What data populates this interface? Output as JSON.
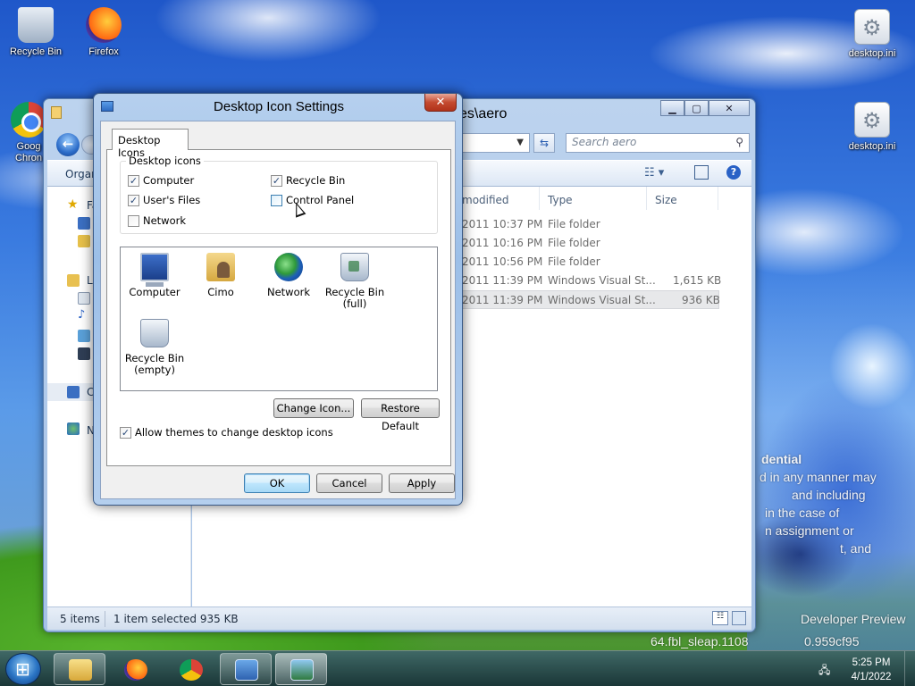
{
  "desktop": {
    "icons": [
      {
        "label": "Recycle Bin",
        "icon": "recycle-bin-icon"
      },
      {
        "label": "Firefox",
        "icon": "firefox-icon"
      },
      {
        "label_line1": "Goog",
        "label_line2": "Chron",
        "icon": "chrome-icon"
      },
      {
        "label": "desktop.ini",
        "icon": "settings-file-icon"
      },
      {
        "label": "desktop.ini",
        "icon": "settings-file-icon"
      }
    ],
    "wallpaper_text": [
      "dential",
      "d in any manner may",
      "and including",
      "in the case of",
      "n assignment or",
      "t, and",
      "Developer Preview",
      "64.fbl_sleap.1108",
      "0.959cf95"
    ]
  },
  "explorer": {
    "title": "es\\aero",
    "search_placeholder": "Search aero",
    "organize_label": "Organ",
    "nav_labels": {
      "favorites": "Fa",
      "libraries": "Li",
      "computer": "C",
      "network": "N"
    },
    "columns": {
      "date": "modified",
      "type": "Type",
      "size": "Size"
    },
    "rows": [
      {
        "date": "2011 10:37 PM",
        "type": "File folder",
        "size": ""
      },
      {
        "date": "2011 10:16 PM",
        "type": "File folder",
        "size": ""
      },
      {
        "date": "2011 10:56 PM",
        "type": "File folder",
        "size": ""
      },
      {
        "date": "2011 11:39 PM",
        "type": "Windows Visual St...",
        "size": "1,615 KB"
      },
      {
        "date": "2011 11:39 PM",
        "type": "Windows Visual St...",
        "size": "936 KB"
      }
    ],
    "status": {
      "count": "5 items",
      "selection": "1 item selected  935 KB"
    }
  },
  "dialog": {
    "title": "Desktop Icon Settings",
    "tab_label": "Desktop Icons",
    "group_label": "Desktop icons",
    "checkboxes": {
      "computer": {
        "label": "Computer",
        "checked": true
      },
      "recycle_bin": {
        "label": "Recycle Bin",
        "checked": true
      },
      "users_files": {
        "label": "User's Files",
        "checked": true
      },
      "control_panel": {
        "label": "Control Panel",
        "checked": false
      },
      "network": {
        "label": "Network",
        "checked": false
      }
    },
    "icon_list": [
      {
        "label": "Computer"
      },
      {
        "label": "Cimo"
      },
      {
        "label": "Network"
      },
      {
        "label": "Recycle Bin",
        "sub": "(full)"
      },
      {
        "label": "Recycle Bin",
        "sub": "(empty)"
      }
    ],
    "buttons": {
      "change_icon": "Change Icon...",
      "restore_default": "Restore Default",
      "ok": "OK",
      "cancel": "Cancel",
      "apply": "Apply"
    },
    "allow_themes": {
      "label": "Allow themes to change desktop icons",
      "checked": true
    }
  },
  "taskbar": {
    "clock_time": "5:25 PM",
    "clock_date": "4/1/2022"
  }
}
